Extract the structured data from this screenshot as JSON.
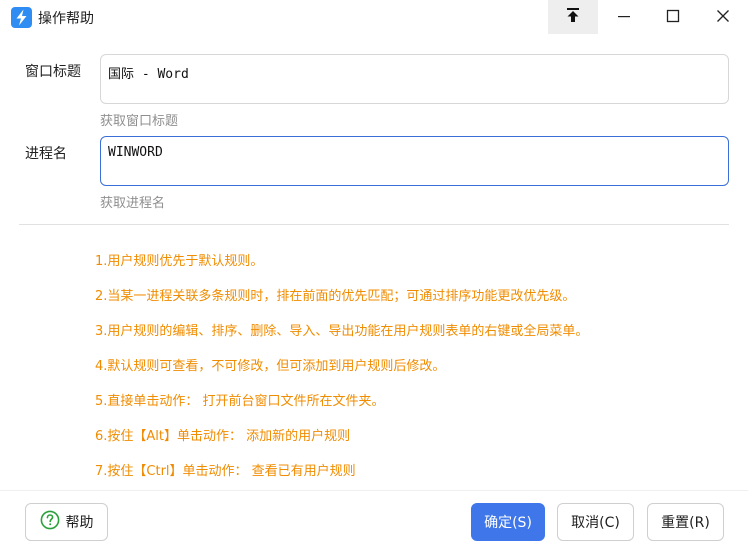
{
  "window": {
    "title": "操作帮助",
    "icons": {
      "app": "lightning-app-icon",
      "pin": "pin-to-top-icon",
      "minimize": "minimize-icon",
      "maximize": "maximize-icon",
      "close": "close-icon"
    }
  },
  "form": {
    "window_title_label": "窗口标题",
    "window_title_value": "国际 - Word",
    "window_title_hint": "获取窗口标题",
    "process_label": "进程名",
    "process_value": "WINWORD",
    "process_hint": "获取进程名"
  },
  "tips": [
    "1.用户规则优先于默认规则。",
    "2.当某一进程关联多条规则时，排在前面的优先匹配；可通过排序功能更改优先级。",
    "3.用户规则的编辑、排序、删除、导入、导出功能在用户规则表单的右键或全局菜单。",
    "4.默认规则可查看，不可修改，但可添加到用户规则后修改。",
    "5.直接单击动作： 打开前台窗口文件所在文件夹。",
    "6.按住【Alt】单击动作： 添加新的用户规则",
    "7.按住【Ctrl】单击动作： 查看已有用户规则"
  ],
  "buttons": {
    "help": "帮助",
    "ok": "确定(S)",
    "cancel": "取消(C)",
    "reset": "重置(R)"
  },
  "colors": {
    "accent": "#3f77ea",
    "tip_text": "#f08c00",
    "hint_text": "#8f8f8f",
    "help_icon": "#2aa13a"
  }
}
